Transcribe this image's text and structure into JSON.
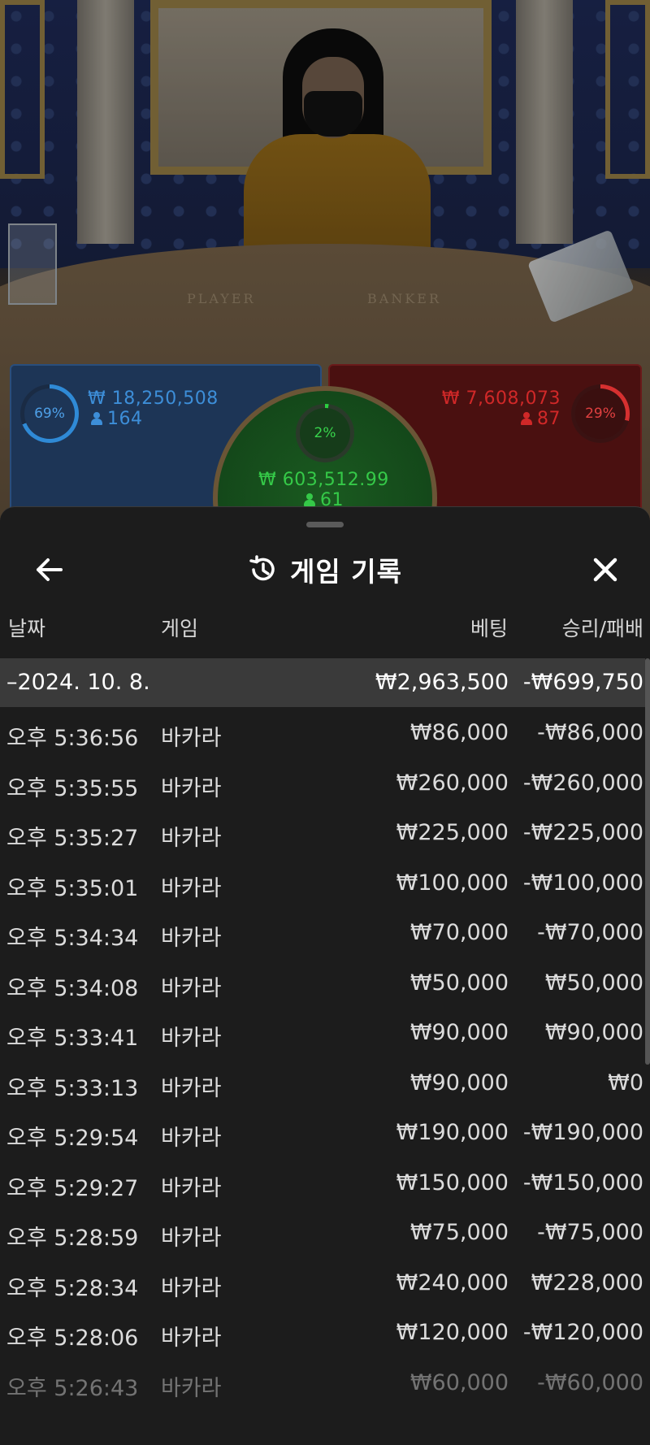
{
  "table": {
    "felt_player": "PLAYER",
    "felt_banker": "BANKER"
  },
  "bets": {
    "player": {
      "percent": "69%",
      "amount": "₩ 18,250,508",
      "players": "164",
      "color": "#3d8ed8"
    },
    "tie": {
      "percent": "2%",
      "amount": "₩ 603,512.99",
      "players": "61",
      "color": "#35c948"
    },
    "banker": {
      "percent": "29%",
      "amount": "₩ 7,608,073",
      "players": "87",
      "color": "#d02828"
    }
  },
  "history": {
    "title": "게임 기록",
    "icons": {
      "back": "arrow-left-icon",
      "history": "history-clock-icon",
      "close": "close-icon"
    },
    "columns": {
      "date": "날짜",
      "game": "게임",
      "bet": "베팅",
      "win_loss": "승리/패배"
    },
    "summary": {
      "date": "–2024. 10. 8.",
      "bet": "₩2,963,500",
      "win_loss": "-₩699,750"
    },
    "rows": [
      {
        "time": "오후 5:36:56",
        "game": "바카라",
        "bet": "₩86,000",
        "win_loss": "-₩86,000"
      },
      {
        "time": "오후 5:35:55",
        "game": "바카라",
        "bet": "₩260,000",
        "win_loss": "-₩260,000"
      },
      {
        "time": "오후 5:35:27",
        "game": "바카라",
        "bet": "₩225,000",
        "win_loss": "-₩225,000"
      },
      {
        "time": "오후 5:35:01",
        "game": "바카라",
        "bet": "₩100,000",
        "win_loss": "-₩100,000"
      },
      {
        "time": "오후 5:34:34",
        "game": "바카라",
        "bet": "₩70,000",
        "win_loss": "-₩70,000"
      },
      {
        "time": "오후 5:34:08",
        "game": "바카라",
        "bet": "₩50,000",
        "win_loss": "₩50,000"
      },
      {
        "time": "오후 5:33:41",
        "game": "바카라",
        "bet": "₩90,000",
        "win_loss": "₩90,000"
      },
      {
        "time": "오후 5:33:13",
        "game": "바카라",
        "bet": "₩90,000",
        "win_loss": "₩0"
      },
      {
        "time": "오후 5:29:54",
        "game": "바카라",
        "bet": "₩190,000",
        "win_loss": "-₩190,000"
      },
      {
        "time": "오후 5:29:27",
        "game": "바카라",
        "bet": "₩150,000",
        "win_loss": "-₩150,000"
      },
      {
        "time": "오후 5:28:59",
        "game": "바카라",
        "bet": "₩75,000",
        "win_loss": "-₩75,000"
      },
      {
        "time": "오후 5:28:34",
        "game": "바카라",
        "bet": "₩240,000",
        "win_loss": "₩228,000"
      },
      {
        "time": "오후 5:28:06",
        "game": "바카라",
        "bet": "₩120,000",
        "win_loss": "-₩120,000"
      },
      {
        "time": "오후 5:26:43",
        "game": "바카라",
        "bet": "₩60,000",
        "win_loss": "-₩60,000"
      }
    ]
  }
}
